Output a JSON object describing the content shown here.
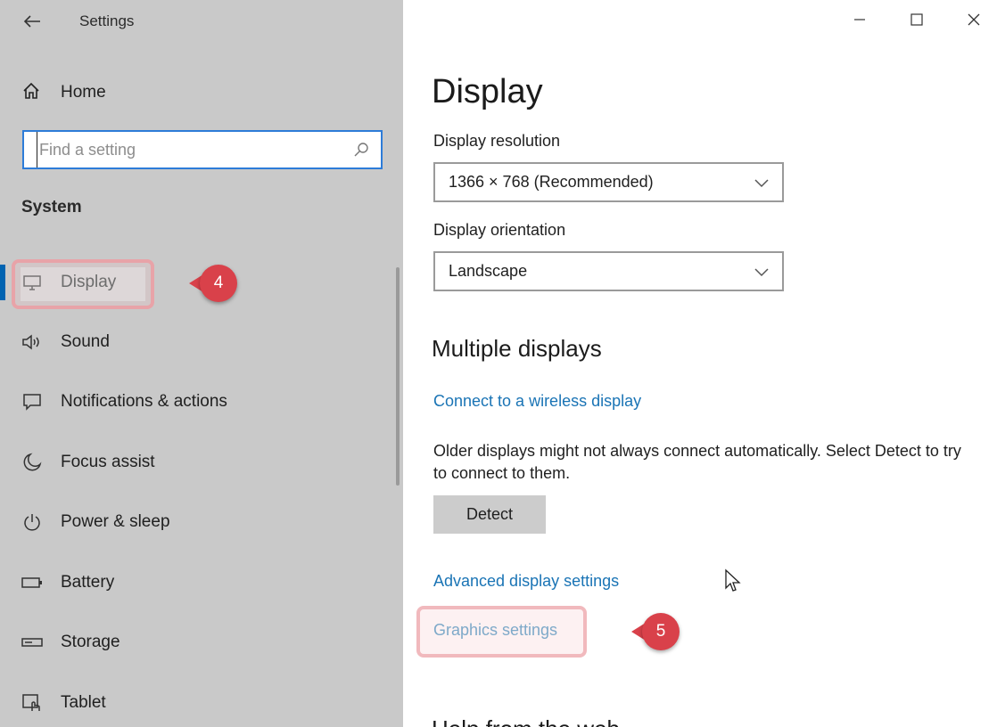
{
  "window": {
    "title": "Settings",
    "controls": [
      "minimize",
      "maximize",
      "close"
    ]
  },
  "sidebar": {
    "home_label": "Home",
    "search_placeholder": "Find a setting",
    "section_title": "System",
    "items": [
      {
        "label": "Display",
        "icon": "monitor-icon",
        "active": true
      },
      {
        "label": "Sound",
        "icon": "speaker-icon"
      },
      {
        "label": "Notifications & actions",
        "icon": "notification-icon"
      },
      {
        "label": "Focus assist",
        "icon": "moon-icon"
      },
      {
        "label": "Power & sleep",
        "icon": "power-icon"
      },
      {
        "label": "Battery",
        "icon": "battery-icon"
      },
      {
        "label": "Storage",
        "icon": "storage-icon"
      },
      {
        "label": "Tablet",
        "icon": "tablet-icon"
      }
    ]
  },
  "callouts": {
    "step_display": "4",
    "step_graphics": "5"
  },
  "main": {
    "title": "Display",
    "resolution_label": "Display resolution",
    "resolution_value": "1366 × 768 (Recommended)",
    "orientation_label": "Display orientation",
    "orientation_value": "Landscape",
    "multiple_displays_heading": "Multiple displays",
    "wireless_link": "Connect to a wireless display",
    "older_displays_text": "Older displays might not always connect automatically. Select Detect to try to connect to them.",
    "detect_button": "Detect",
    "advanced_link": "Advanced display settings",
    "graphics_link": "Graphics settings",
    "cut_heading": "Help from the web"
  },
  "colors": {
    "accent": "#0063b1",
    "link": "#1a74b5",
    "callout": "#d9414a",
    "sidebar_bg": "#c9c9c9"
  }
}
